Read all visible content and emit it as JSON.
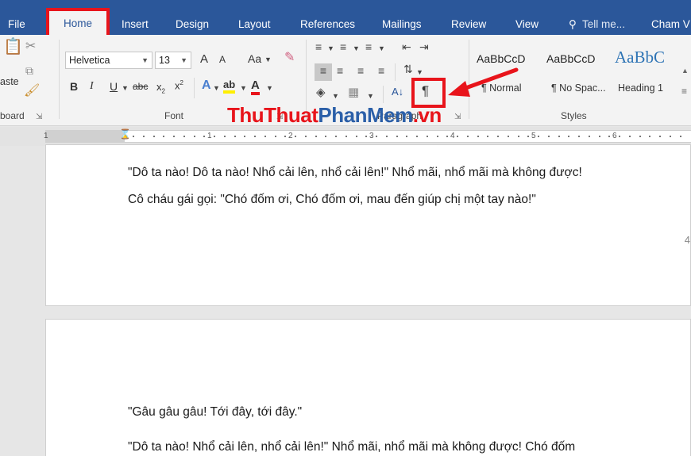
{
  "tabs": {
    "file": "File",
    "home": "Home",
    "insert": "Insert",
    "design": "Design",
    "layout": "Layout",
    "references": "References",
    "mailings": "Mailings",
    "review": "Review",
    "view": "View",
    "tell_me": "Tell me...",
    "user": "Cham V"
  },
  "clipboard": {
    "paste_label": "aste",
    "group_label": "board"
  },
  "font": {
    "family": "Helvetica",
    "size": "13",
    "grow": "A",
    "shrink": "A",
    "change_case": "Aa",
    "bold": "B",
    "italic": "I",
    "underline": "U",
    "strike": "abc",
    "subscript": "x",
    "superscript": "x",
    "text_effects": "A",
    "highlight": "ab",
    "font_color": "A",
    "group_label": "Font"
  },
  "paragraph": {
    "show_hide": "¶",
    "sort": "A↓",
    "group_label": "Paragraph"
  },
  "styles": {
    "items": [
      {
        "preview": "AaBbCcD",
        "name": "¶ Normal"
      },
      {
        "preview": "AaBbCcD",
        "name": "¶ No Spac..."
      },
      {
        "preview": "AaBbC",
        "name": "Heading 1"
      }
    ],
    "group_label": "Styles"
  },
  "watermark": {
    "part1": "ThuThuat",
    "part2": "PhanMem",
    "part3": ".vn"
  },
  "ruler": {
    "numbers": [
      "1",
      "1",
      "2",
      "3",
      "4",
      "5",
      "6"
    ]
  },
  "document": {
    "page1_lines": [
      "\"Dô ta nào! Dô ta nào! Nhổ cải lên, nhổ cải lên!\" Nhổ mãi, nhổ mãi mà không được!",
      "Cô cháu gái gọi: \"Chó đốm ơi, Chó đốm ơi, mau đến giúp chị một tay nào!\""
    ],
    "page1_number": "4",
    "page2_lines": [
      "\"Gâu gâu gâu! Tới đây, tới đây.\"",
      "\"Dô ta nào! Nhổ cải lên, nhổ cải lên!\" Nhổ mãi, nhổ mãi mà không được! Chó đốm"
    ]
  },
  "colors": {
    "tab_bar": "#2b579a",
    "annotation": "#e8141b",
    "watermark_main": "#e8141b",
    "watermark_accent": "#2b5fa8"
  }
}
